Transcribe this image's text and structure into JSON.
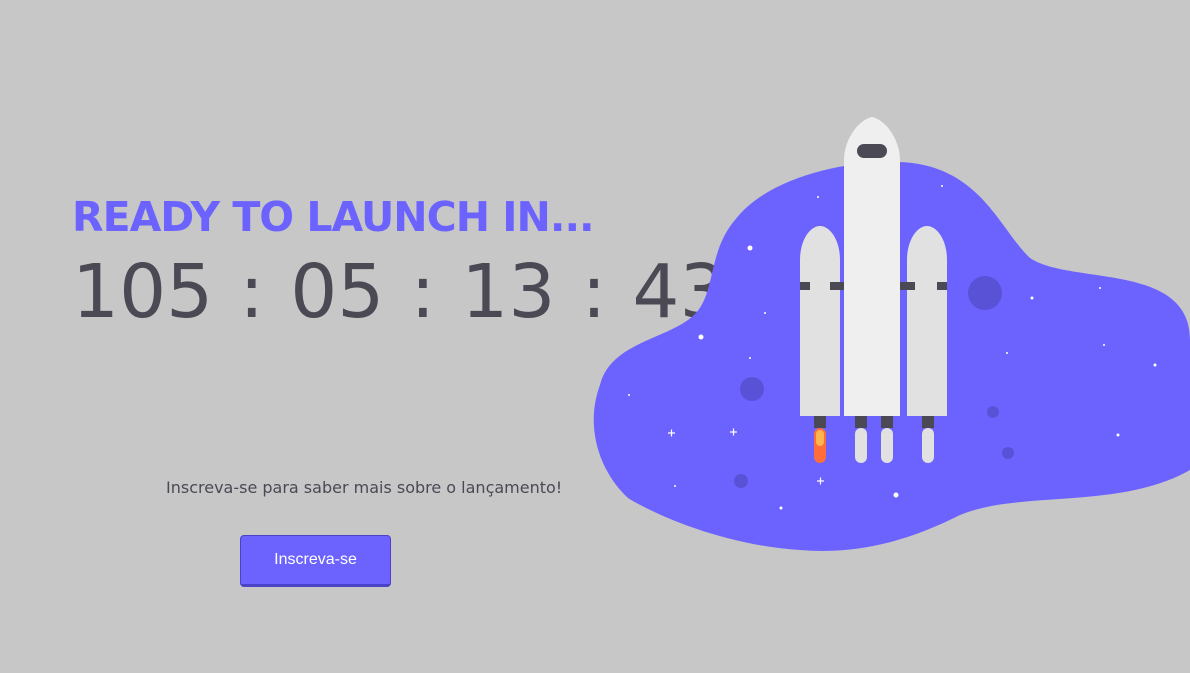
{
  "hero": {
    "headline": "READY TO LAUNCH IN...",
    "countdown": {
      "days": "105",
      "hours": "05",
      "minutes": "13",
      "seconds": "43",
      "separator": ":"
    },
    "subtitle": "Inscreva-se para saber mais sobre o lançamento!",
    "cta_label": "Inscreva-se"
  },
  "colors": {
    "background": "#c7c7c7",
    "accent": "#6c63ff",
    "text": "#4a4954",
    "rocket_body": "#efefef",
    "rocket_booster": "#e1e1e1",
    "flame": "#ff6d3b"
  },
  "icons": {
    "illustration": "rocket-launch-illustration"
  }
}
